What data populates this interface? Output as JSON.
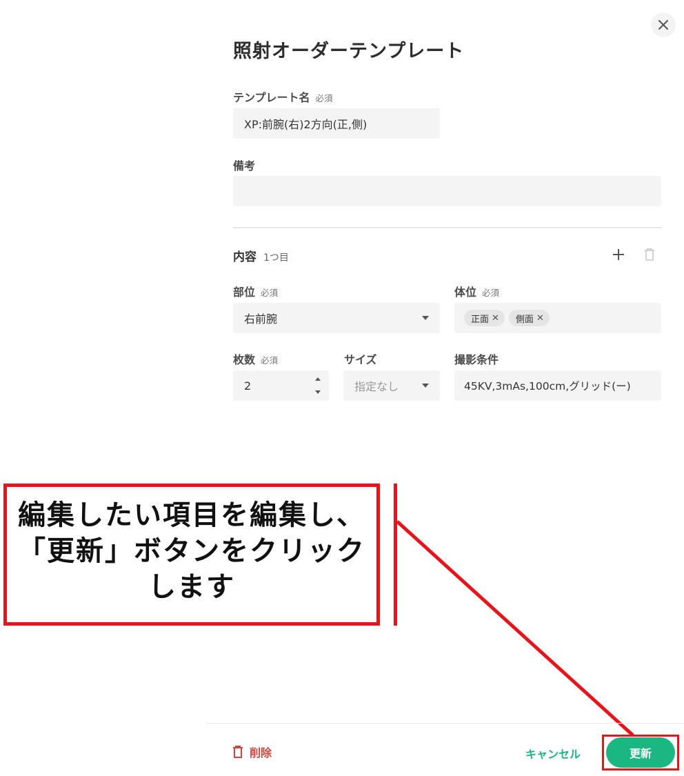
{
  "dialog": {
    "title": "照射オーダーテンプレート",
    "close_icon": "close-icon"
  },
  "template_name": {
    "label": "テンプレート名",
    "required": "必須",
    "value": "XP:前腕(右)2方向(正,側)"
  },
  "remarks": {
    "label": "備考",
    "value": ""
  },
  "content": {
    "label": "内容",
    "index": "1つ目",
    "add_icon": "plus-icon",
    "delete_icon": "trash-icon"
  },
  "site": {
    "label": "部位",
    "required": "必須",
    "value": "右前腕"
  },
  "position": {
    "label": "体位",
    "required": "必須",
    "chips": [
      "正面",
      "側面"
    ]
  },
  "count": {
    "label": "枚数",
    "required": "必須",
    "value": "2"
  },
  "size": {
    "label": "サイズ",
    "placeholder": "指定なし"
  },
  "conditions": {
    "label": "撮影条件",
    "value": "45KV,3mAs,100cm,グリッド(ー)"
  },
  "annotation": {
    "line1": "編集したい項目を編集し、",
    "line2": "「更新」ボタンをクリック",
    "line3": "します",
    "color": "#e8141b"
  },
  "footer": {
    "delete_label": "削除",
    "cancel_label": "キャンセル",
    "update_label": "更新",
    "accent": "#1bb782",
    "danger": "#d6453d"
  }
}
